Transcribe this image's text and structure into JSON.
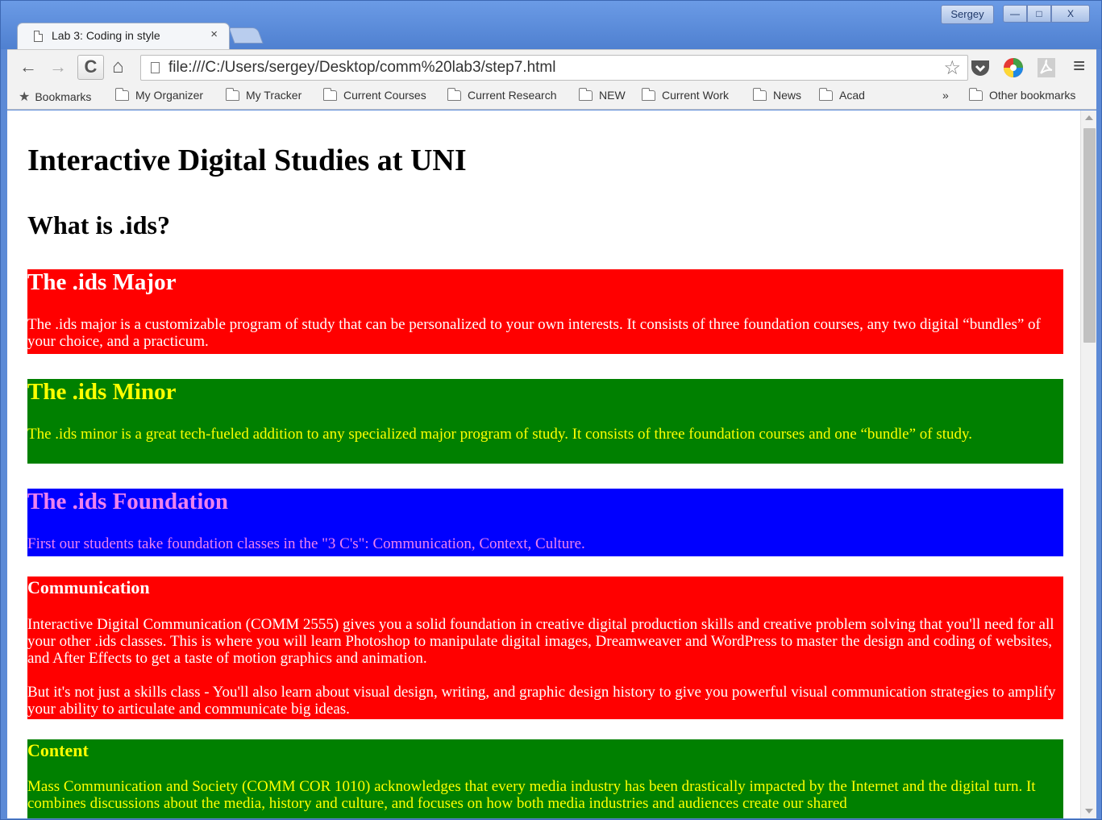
{
  "browser": {
    "tab_title": "Lab 3: Coding in style",
    "tab_close": "×",
    "user_name": "Sergey",
    "window_controls": {
      "minimize": "—",
      "maximize": "□",
      "close": "X"
    },
    "nav": {
      "back": "←",
      "forward": "→",
      "reload": "C",
      "home": "⌂"
    },
    "url": "file:///C:/Users/sergey/Desktop/comm%20lab3/step7.html",
    "menu_icon": "≡",
    "bookmarks": {
      "label": "Bookmarks",
      "items": [
        "My Organizer",
        "My Tracker",
        "Current Courses",
        "Current Research",
        "NEW",
        "Current Work",
        "News",
        "Acad"
      ],
      "overflow": "»",
      "other": "Other bookmarks"
    }
  },
  "page": {
    "title": "Interactive Digital Studies at UNI",
    "subtitle": "What is .ids?",
    "sections": [
      {
        "heading": "The .ids Major",
        "paragraphs": [
          "The .ids major is a customizable program of study that can be personalized to your own interests. It consists of three foundation courses, any two digital “bundles” of your choice, and a practicum."
        ]
      },
      {
        "heading": "The .ids Minor",
        "paragraphs": [
          "The .ids minor is a great tech-fueled addition to any specialized major program of study. It consists of three foundation courses and one “bundle” of study."
        ]
      },
      {
        "heading": "The .ids Foundation",
        "paragraphs": [
          "First our students take foundation classes in the \"3 C's\": Communication, Context, Culture."
        ]
      },
      {
        "heading": "Communication",
        "paragraphs": [
          "Interactive Digital Communication (COMM 2555) gives you a solid foundation in creative digital production skills and creative problem solving that you'll need for all your other .ids classes. This is where you will learn Photoshop to manipulate digital images, Dreamweaver and WordPress to master the design and coding of websites, and After Effects to get a taste of motion graphics and animation.",
          "But it's not just a skills class - You'll also learn about visual design, writing, and graphic design history to give you powerful visual communication strategies to amplify your ability to articulate and communicate big ideas."
        ]
      },
      {
        "heading": "Content",
        "paragraphs": [
          "Mass Communication and Society (COMM COR 1010) acknowledges that every media industry has been drastically impacted by the Internet and the digital turn. It combines discussions about the media, history and culture, and focuses on how both media industries and audiences create our shared"
        ]
      }
    ]
  }
}
